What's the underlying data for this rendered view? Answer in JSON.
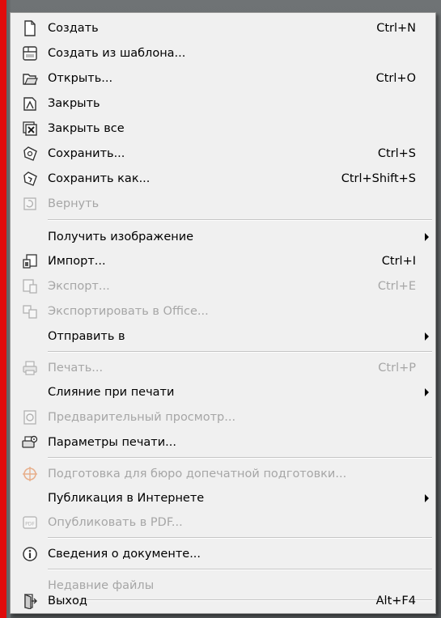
{
  "colors": {
    "menu_bg": "#f0f0f0",
    "text": "#000000",
    "disabled_text": "#a6a6a6",
    "left_red_bar": "#e10b0b"
  },
  "menu": {
    "items": [
      {
        "label": "Создать",
        "shortcut": "Ctrl+N",
        "icon": "new-document-icon",
        "enabled": true
      },
      {
        "label": "Создать из шаблона...",
        "shortcut": "",
        "icon": "new-from-template-icon",
        "enabled": true
      },
      {
        "label": "Открыть...",
        "shortcut": "Ctrl+O",
        "icon": "open-folder-icon",
        "enabled": true
      },
      {
        "label": "Закрыть",
        "shortcut": "",
        "icon": "close-document-icon",
        "enabled": true
      },
      {
        "label": "Закрыть все",
        "shortcut": "",
        "icon": "close-all-icon",
        "enabled": true
      },
      {
        "label": "Сохранить...",
        "shortcut": "Ctrl+S",
        "icon": "save-icon",
        "enabled": true
      },
      {
        "label": "Сохранить как...",
        "shortcut": "Ctrl+Shift+S",
        "icon": "save-as-icon",
        "enabled": true
      },
      {
        "label": "Вернуть",
        "shortcut": "",
        "icon": "revert-icon",
        "enabled": false
      },
      {
        "label": "Получить изображение",
        "shortcut": "",
        "icon": "",
        "enabled": true,
        "submenu": true
      },
      {
        "label": "Импорт...",
        "shortcut": "Ctrl+I",
        "icon": "import-icon",
        "enabled": true
      },
      {
        "label": "Экспорт...",
        "shortcut": "Ctrl+E",
        "icon": "export-icon",
        "enabled": false
      },
      {
        "label": "Экспортировать в Office...",
        "shortcut": "",
        "icon": "export-office-icon",
        "enabled": false
      },
      {
        "label": "Отправить в",
        "shortcut": "",
        "icon": "",
        "enabled": true,
        "submenu": true
      },
      {
        "label": "Печать...",
        "shortcut": "Ctrl+P",
        "icon": "print-icon",
        "enabled": false
      },
      {
        "label": "Слияние при печати",
        "shortcut": "",
        "icon": "",
        "enabled": true,
        "submenu": true
      },
      {
        "label": "Предварительный просмотр...",
        "shortcut": "",
        "icon": "print-preview-icon",
        "enabled": false
      },
      {
        "label": "Параметры печати...",
        "shortcut": "",
        "icon": "print-settings-icon",
        "enabled": true
      },
      {
        "label": "Подготовка для бюро допечатной подготовки...",
        "shortcut": "",
        "icon": "prepress-icon",
        "enabled": false
      },
      {
        "label": "Публикация в Интернете",
        "shortcut": "",
        "icon": "",
        "enabled": true,
        "submenu": true
      },
      {
        "label": "Опубликовать в PDF...",
        "shortcut": "",
        "icon": "pdf-icon",
        "enabled": false
      },
      {
        "label": "Сведения о документе...",
        "shortcut": "",
        "icon": "info-icon",
        "enabled": true
      },
      {
        "label": "Недавние файлы",
        "shortcut": "",
        "icon": "",
        "enabled": false
      },
      {
        "label": "Выход",
        "shortcut": "Alt+F4",
        "icon": "exit-icon",
        "enabled": true
      }
    ]
  }
}
